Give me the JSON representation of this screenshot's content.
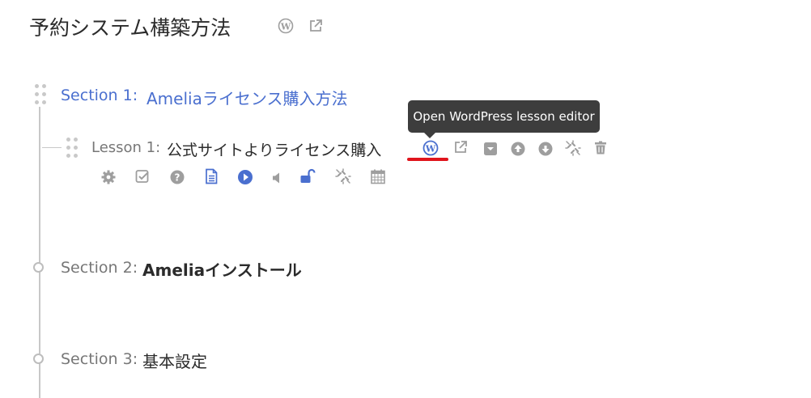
{
  "header": {
    "title": "予約システム構築方法",
    "icons": [
      "wordpress-icon",
      "external-link-icon"
    ]
  },
  "sections": [
    {
      "label": "Section 1:",
      "title": "Ameliaライセンス購入方法",
      "state": "active",
      "lessons": [
        {
          "label": "Lesson 1:",
          "title": "公式サイトよりライセンス購入",
          "actions": [
            "wordpress-icon",
            "external-link-icon",
            "collapse-icon",
            "move-up-icon",
            "move-down-icon",
            "unlink-icon",
            "trash-icon"
          ],
          "options": [
            "settings-icon",
            "checkbox-icon",
            "help-icon",
            "document-icon",
            "play-icon",
            "audio-icon",
            "unlock-icon",
            "unlink-icon",
            "calendar-icon"
          ]
        }
      ]
    },
    {
      "label": "Section 2:",
      "title": "Ameliaインストール",
      "state": "collapsed"
    },
    {
      "label": "Section 3:",
      "title": "基本設定",
      "state": "collapsed"
    }
  ],
  "tooltip": {
    "text": "Open WordPress lesson editor"
  },
  "colors": {
    "accent": "#4a6fcf",
    "icon_gray": "#9e9e9e",
    "timeline": "#c8c8c8",
    "tooltip_bg": "#3d3d3d",
    "highlight": "#e0141c"
  }
}
